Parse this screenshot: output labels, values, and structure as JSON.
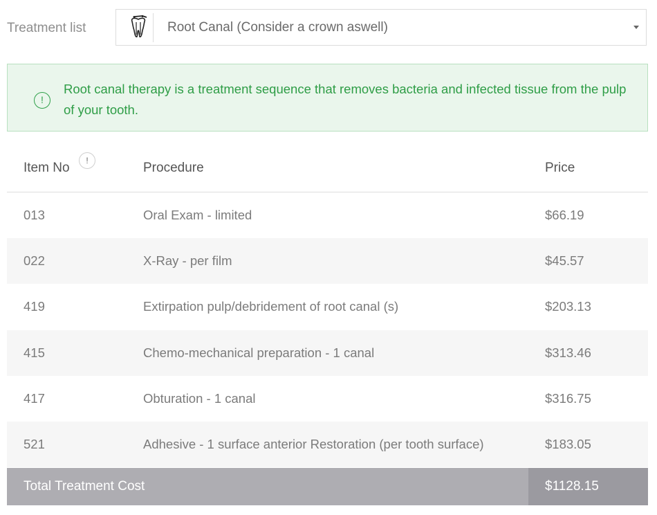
{
  "treatment": {
    "label": "Treatment list",
    "selected": "Root Canal (Consider a crown aswell)",
    "icon": "tooth-icon"
  },
  "info": {
    "text": "Root canal therapy is a treatment sequence that removes bacteria and infected tissue from the pulp of your tooth.",
    "icon": "info-icon",
    "color": "#2e9d46"
  },
  "table": {
    "headers": {
      "item_no": "Item No",
      "procedure": "Procedure",
      "price": "Price",
      "item_badge": "!"
    },
    "rows": [
      {
        "item": "013",
        "procedure": "Oral Exam - limited",
        "price": "$66.19"
      },
      {
        "item": "022",
        "procedure": "X-Ray - per film",
        "price": "$45.57"
      },
      {
        "item": "419",
        "procedure": "Extirpation pulp/debridement of root canal (s)",
        "price": "$203.13"
      },
      {
        "item": "415",
        "procedure": "Chemo-mechanical preparation - 1 canal",
        "price": "$313.46"
      },
      {
        "item": "417",
        "procedure": "Obturation - 1 canal",
        "price": "$316.75"
      },
      {
        "item": "521",
        "procedure": "Adhesive - 1 surface anterior Restoration (per tooth surface)",
        "price": "$183.05"
      }
    ]
  },
  "total": {
    "label": "Total Treatment Cost",
    "amount": "$1128.15"
  }
}
